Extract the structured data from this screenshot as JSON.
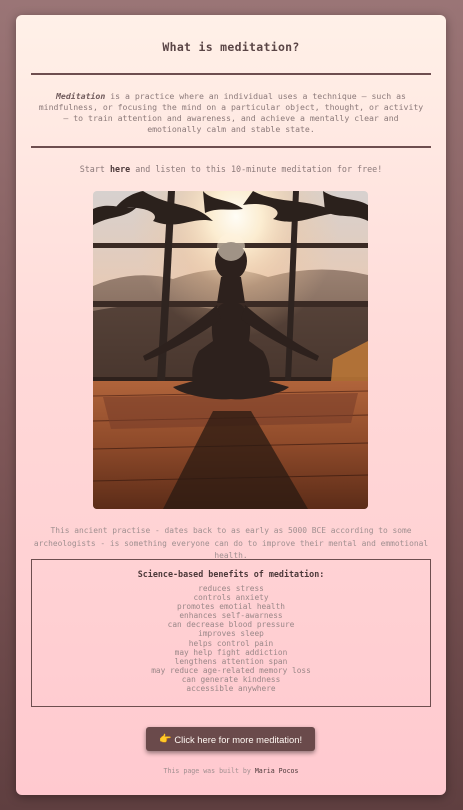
{
  "header": {
    "title": "What is meditation?"
  },
  "intro": {
    "term": "Meditation",
    "definition": " is a practice where an individual uses a technique – such as mindfulness, or focusing the mind on a particular object, thought, or activity – to train attention and awareness, and achieve a mentally clear and emotionally calm and stable state."
  },
  "start": {
    "prefix": "Start ",
    "link_label": "here",
    "suffix": " and listen to this 10-minute meditation for free!"
  },
  "hero_image": {
    "alt": "Person meditating in lotus pose at sunset under palm trees"
  },
  "history": {
    "text": "This ancient practise - dates back to as early as 5000 BCE according to some archeologists - is something everyone can do to improve their mental and emmotional health."
  },
  "benefits": {
    "heading": "Science-based benefits of meditation:",
    "items": [
      "reduces stress",
      "controls anxiety",
      "promotes emotial health",
      "enhances self-awarness",
      "can decrease blood pressure",
      "improves sleep",
      "helps control pain",
      "may help fight addiction",
      "lengthens attention span",
      "may reduce age-related memory loss",
      "can generate kindness",
      "accessible anywhere"
    ]
  },
  "cta": {
    "icon": "pointing-hand-icon",
    "glyph": "👉",
    "label": "Click here for more meditation!"
  },
  "footer": {
    "prefix": "This page was built by ",
    "author": "Maria Pocos"
  },
  "colors": {
    "button": "#6a4a4b",
    "rule": "#6e4e4f",
    "background_top": "#9a7576",
    "card_bottom": "#ffc9cf"
  }
}
